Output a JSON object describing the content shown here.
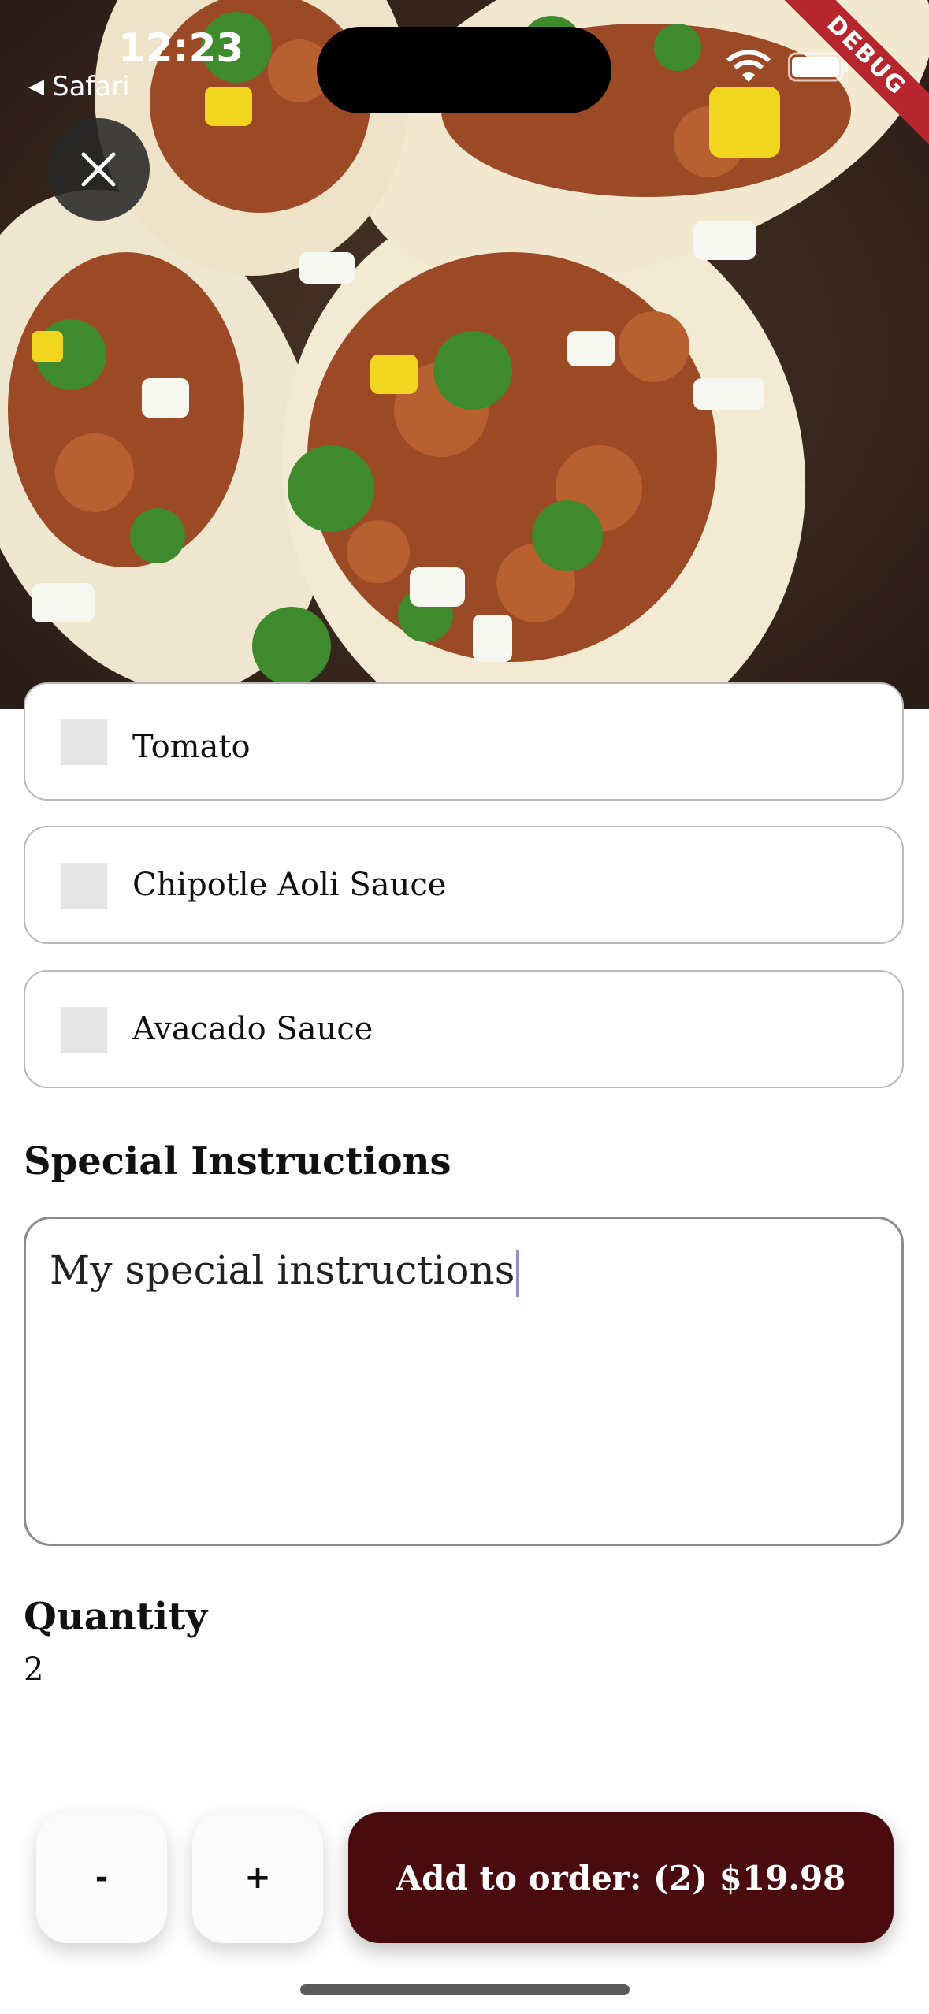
{
  "status_bar": {
    "time": "12:23",
    "back_app": "Safari",
    "debug_banner": "DEBUG"
  },
  "options": [
    {
      "label": "Tomato",
      "checked": false
    },
    {
      "label": "Chipotle Aoli Sauce",
      "checked": false
    },
    {
      "label": "Avacado Sauce",
      "checked": false
    }
  ],
  "special_instructions": {
    "title": "Special Instructions",
    "value": "My special instructions"
  },
  "quantity": {
    "title": "Quantity",
    "value": "2",
    "decrement_label": "-",
    "increment_label": "+"
  },
  "add_to_order": {
    "label": "Add to order: (2) $19.98"
  },
  "colors": {
    "add_button_bg": "#4a0b0f",
    "debug_banner": "#b8262d"
  },
  "icons": {
    "close": "close-icon",
    "wifi": "wifi-icon",
    "battery": "battery-icon",
    "back": "back-triangle-icon"
  }
}
